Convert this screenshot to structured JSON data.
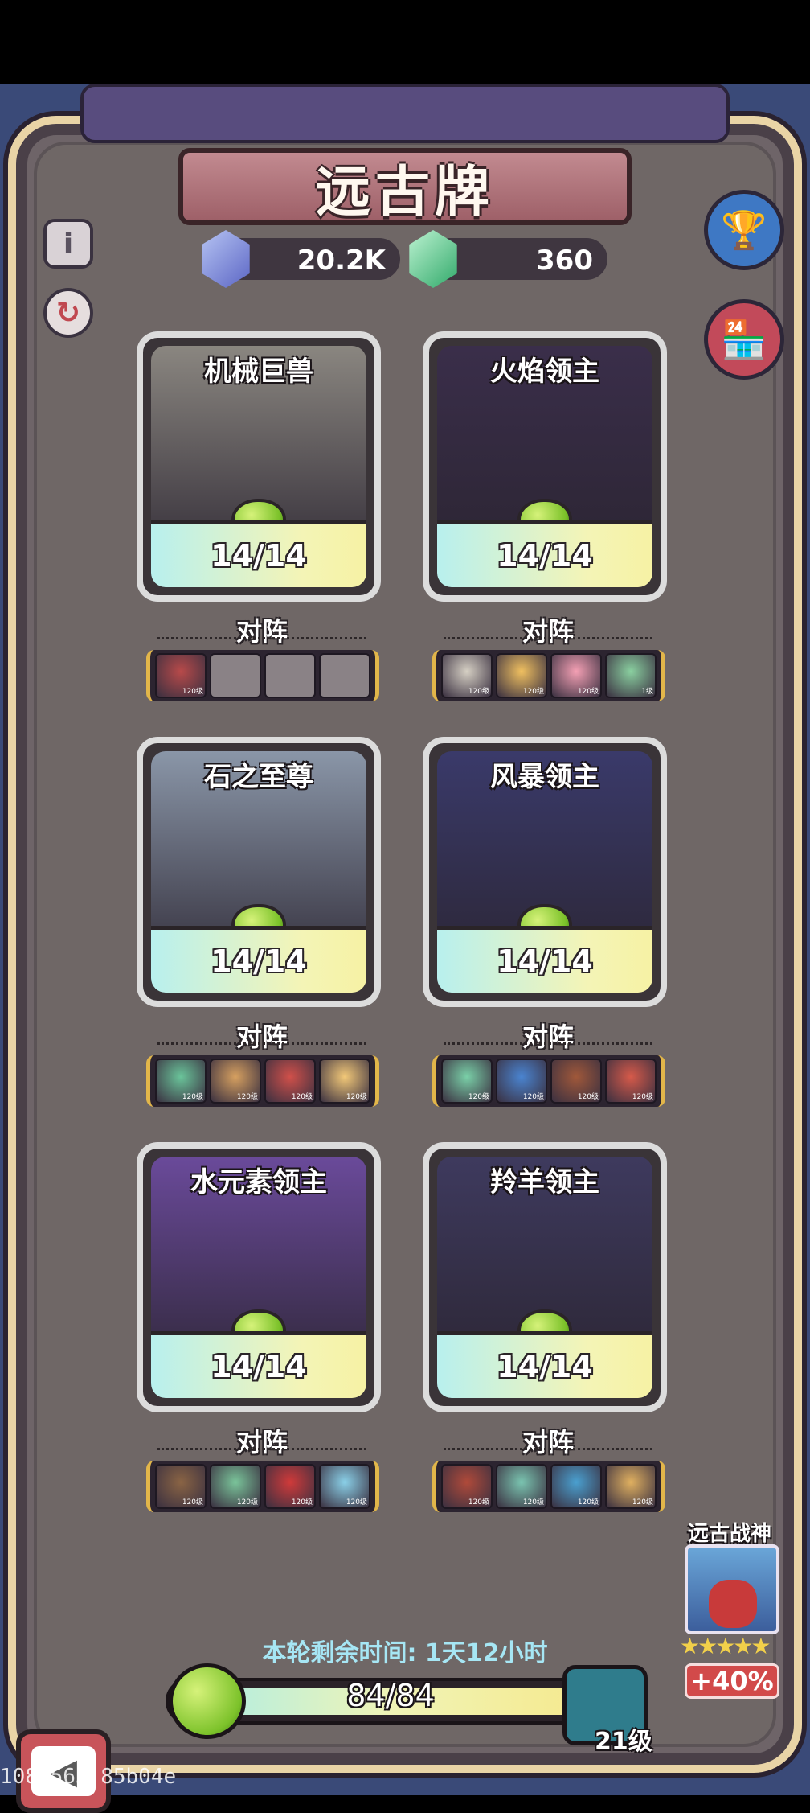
{
  "title": "远古牌",
  "currencies": {
    "blue_gem": "20.2K",
    "green_gem": "360"
  },
  "buttons": {
    "info": "i",
    "refresh": "↻",
    "rank": "🏆",
    "shop": "🏪",
    "back": "◀"
  },
  "team_label": "对阵",
  "cards": [
    {
      "name": "机械巨兽",
      "progress": "14/14",
      "art_color": "#8a8680"
    },
    {
      "name": "火焰领主",
      "progress": "14/14",
      "art_color": "#3a2e4a"
    },
    {
      "name": "石之至尊",
      "progress": "14/14",
      "art_color": "#8a96a8"
    },
    {
      "name": "风暴领主",
      "progress": "14/14",
      "art_color": "#3a3a6a"
    },
    {
      "name": "水元素领主",
      "progress": "14/14",
      "art_color": "#6a4a9a"
    },
    {
      "name": "羚羊领主",
      "progress": "14/14",
      "art_color": "#3e3a5e"
    }
  ],
  "teams": [
    {
      "heroes": [
        "#b84a4a",
        "",
        "",
        ""
      ],
      "levels": [
        "120级",
        "",
        "",
        ""
      ]
    },
    {
      "heroes": [
        "#d6d0c4",
        "#f0c060",
        "#f4a0b4",
        "#8ad0a0"
      ],
      "levels": [
        "120级",
        "120级",
        "120级",
        "1级"
      ]
    },
    {
      "heroes": [
        "#6ac49a",
        "#d6a060",
        "#d0504a",
        "#f2c878"
      ],
      "levels": [
        "120级",
        "120级",
        "120级",
        "120级"
      ]
    },
    {
      "heroes": [
        "#7ad0a8",
        "#4a84d0",
        "#a0583a",
        "#d65a4a"
      ],
      "levels": [
        "120级",
        "120级",
        "120级",
        "120级"
      ]
    },
    {
      "heroes": [
        "#8a6444",
        "#7ac49a",
        "#d03a3a",
        "#8ad0e8"
      ],
      "levels": [
        "120级",
        "120级",
        "120级",
        "120级"
      ]
    },
    {
      "heroes": [
        "#b04a3a",
        "#7ac4b0",
        "#4aa0d0",
        "#e0b060"
      ],
      "levels": [
        "120级",
        "120级",
        "120级",
        "120级"
      ]
    }
  ],
  "timer_text": "本轮剩余时间: 1天12小时",
  "progress": {
    "text": "84/84",
    "fraction": 1.0
  },
  "level_text": "21级",
  "ancient_god": {
    "title": "远古战神",
    "stars": "★★★★★",
    "bonus": "+40%"
  },
  "watermark": "1087563 85b04e"
}
